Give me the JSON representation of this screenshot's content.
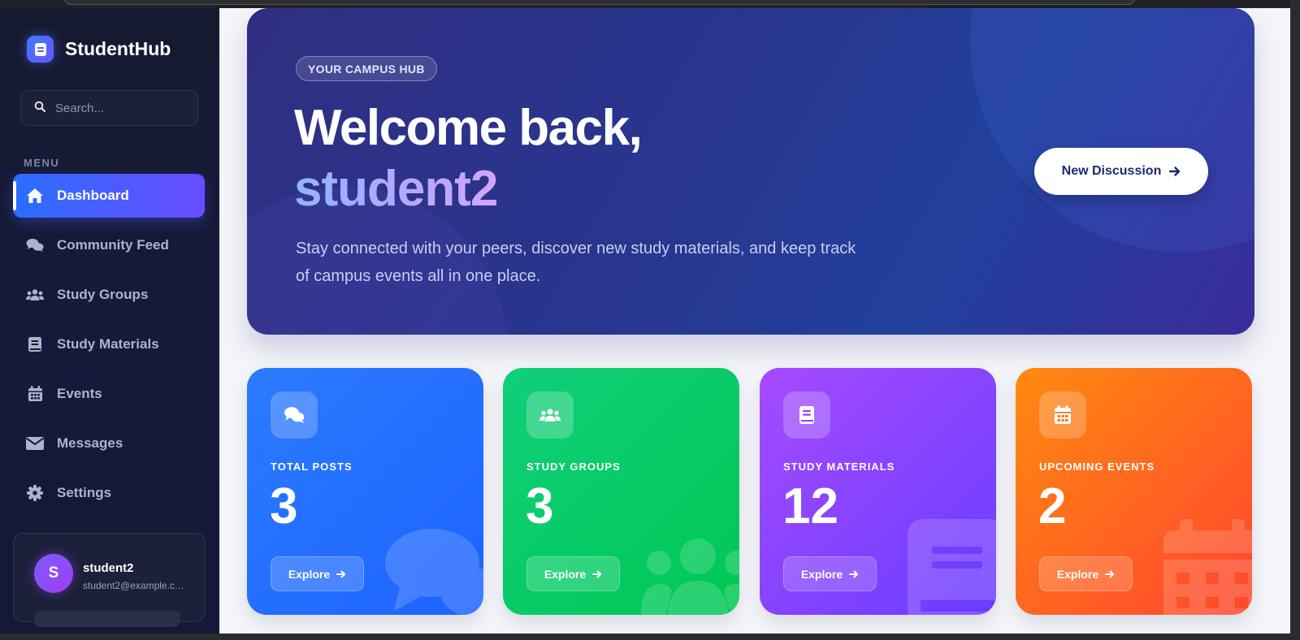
{
  "app": {
    "brand": "StudentHub"
  },
  "sidebar": {
    "search_placeholder": "Search...",
    "menu_label": "MENU",
    "items": [
      {
        "label": "Dashboard",
        "icon": "home-icon",
        "active": true
      },
      {
        "label": "Community Feed",
        "icon": "comments-icon",
        "active": false
      },
      {
        "label": "Study Groups",
        "icon": "users-icon",
        "active": false
      },
      {
        "label": "Study Materials",
        "icon": "book-icon",
        "active": false
      },
      {
        "label": "Events",
        "icon": "calendar-icon",
        "active": false
      },
      {
        "label": "Messages",
        "icon": "envelope-icon",
        "active": false
      },
      {
        "label": "Settings",
        "icon": "gear-icon",
        "active": false
      }
    ],
    "user": {
      "initial": "S",
      "name": "student2",
      "email": "student2@example.com"
    }
  },
  "hero": {
    "tag": "YOUR CAMPUS HUB",
    "title": "Welcome back,",
    "username": "student2",
    "description": "Stay connected with your peers, discover new study materials, and keep track of campus events all in one place.",
    "button_label": "New Discussion"
  },
  "stats": [
    {
      "label": "TOTAL POSTS",
      "value": "3",
      "button": "Explore",
      "icon": "comments-icon",
      "color": "#1d63ff"
    },
    {
      "label": "STUDY GROUPS",
      "value": "3",
      "button": "Explore",
      "icon": "users-icon",
      "color": "#00c853"
    },
    {
      "label": "STUDY MATERIALS",
      "value": "12",
      "button": "Explore",
      "icon": "book-icon",
      "color": "#7b3cff"
    },
    {
      "label": "UPCOMING EVENTS",
      "value": "2",
      "button": "Explore",
      "icon": "calendar-icon",
      "color": "#ff5a24"
    }
  ],
  "colors": {
    "sidebar_bg": "#151a30",
    "accent_start": "#2a6dff",
    "accent_end": "#6a4bff",
    "hero_bg": "#2b3690",
    "main_bg": "#f4f5f9"
  }
}
